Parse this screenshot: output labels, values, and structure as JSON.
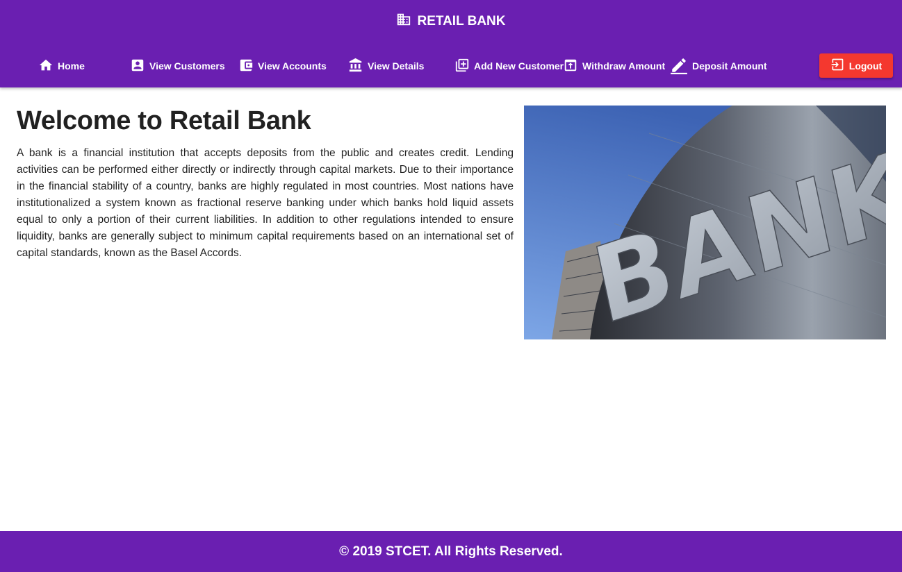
{
  "app": {
    "brand_icon": "building-icon",
    "title": "RETAIL BANK"
  },
  "nav": {
    "items": [
      {
        "label": "Home",
        "icon": "home-icon"
      },
      {
        "label": "View Customers",
        "icon": "account-box-icon"
      },
      {
        "label": "View Accounts",
        "icon": "wallet-icon"
      },
      {
        "label": "View Details",
        "icon": "bank-icon"
      },
      {
        "label": "Add New Customer",
        "icon": "library-add-icon"
      },
      {
        "label": "Withdraw Amount",
        "icon": "upload-box-icon"
      },
      {
        "label": "Deposit Amount",
        "icon": "pencil-icon"
      }
    ],
    "logout": {
      "label": "Logout",
      "icon": "logout-icon"
    }
  },
  "main": {
    "heading": "Welcome to Retail Bank",
    "paragraph": "A bank is a financial institution that accepts deposits from the public and creates credit. Lending activities can be performed either directly or indirectly through capital markets. Due to their importance in the financial stability of a country, banks are highly regulated in most countries. Most nations have institutionalized a system known as fractional reserve banking under which banks hold liquid assets equal to only a portion of their current liabilities. In addition to other regulations intended to ensure liquidity, banks are generally subject to minimum capital requirements based on an international set of capital standards, known as the Basel Accords.",
    "hero_image": {
      "sign_text": "BANK"
    }
  },
  "footer": {
    "text": "© 2019 STCET. All Rights Reserved."
  },
  "colors": {
    "primary": "#6a1fb1",
    "danger": "#f4382f",
    "text": "#212121"
  }
}
